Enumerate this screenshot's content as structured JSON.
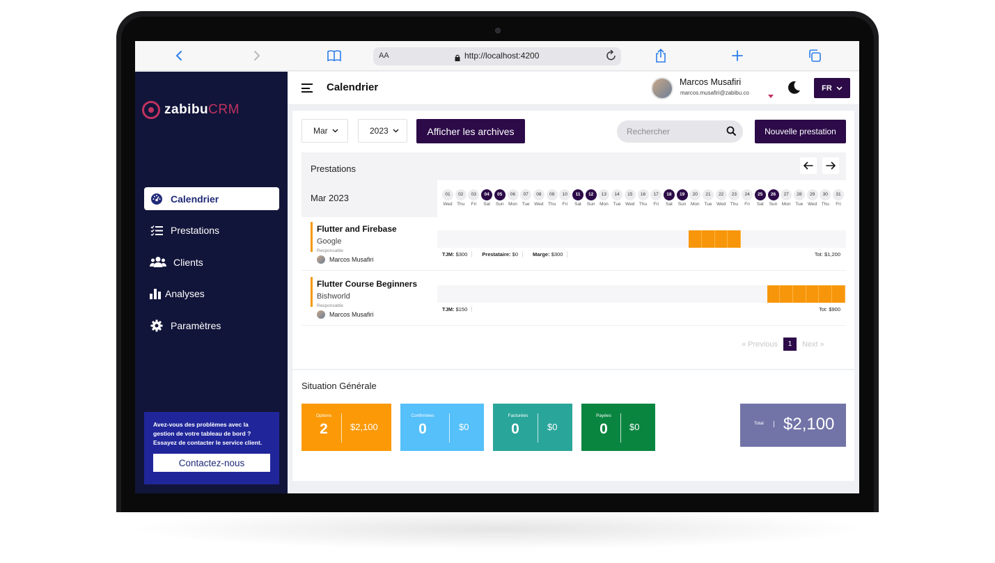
{
  "browser": {
    "url_aa": "AA",
    "url": "http://localhost:4200",
    "icons": [
      "back-icon",
      "forward-icon",
      "bookmarks-icon",
      "lock-icon",
      "reload-icon",
      "share-icon",
      "plus-icon",
      "tabs-icon"
    ]
  },
  "brand": {
    "name_main": "zabibu",
    "name_suffix": "CRM",
    "color": "#c0325f"
  },
  "sidebar": {
    "items": [
      {
        "label": "Calendrier",
        "icon": "dashboard-gauge-icon",
        "active": true
      },
      {
        "label": "Prestations",
        "icon": "checklist-icon",
        "active": false
      },
      {
        "label": "Clients",
        "icon": "users-icon",
        "active": false
      },
      {
        "label": "Analyses",
        "icon": "bar-chart-icon",
        "active": false
      },
      {
        "label": "Paramètres",
        "icon": "gear-icon",
        "active": false
      }
    ],
    "help_text": "Avez-vous des problèmes avec la gestion de votre tableau de bord ? Essayez de contacter le service client.",
    "help_button": "Contactez-nous"
  },
  "header": {
    "title": "Calendrier",
    "user_name": "Marcos Musafiri",
    "user_email": "marcos.musafiri@zabibu.co",
    "lang": "FR"
  },
  "filters": {
    "month": "Mar",
    "year": "2023",
    "archive_button": "Afficher les archives",
    "search_placeholder": "Rechercher",
    "new_button": "Nouvelle prestation"
  },
  "calendar": {
    "title": "Prestations",
    "month_label": "Mar 2023",
    "days": [
      {
        "num": "01",
        "name": "Wed",
        "hl": false
      },
      {
        "num": "02",
        "name": "Thu",
        "hl": false
      },
      {
        "num": "03",
        "name": "Fri",
        "hl": false
      },
      {
        "num": "04",
        "name": "Sat",
        "hl": true
      },
      {
        "num": "05",
        "name": "Sun",
        "hl": true
      },
      {
        "num": "06",
        "name": "Mon",
        "hl": false
      },
      {
        "num": "07",
        "name": "Tue",
        "hl": false
      },
      {
        "num": "08",
        "name": "Wed",
        "hl": false
      },
      {
        "num": "09",
        "name": "Thu",
        "hl": false
      },
      {
        "num": "10",
        "name": "Fri",
        "hl": false
      },
      {
        "num": "11",
        "name": "Sat",
        "hl": true
      },
      {
        "num": "12",
        "name": "Sun",
        "hl": true
      },
      {
        "num": "13",
        "name": "Mon",
        "hl": false
      },
      {
        "num": "14",
        "name": "Tue",
        "hl": false
      },
      {
        "num": "15",
        "name": "Wed",
        "hl": false
      },
      {
        "num": "16",
        "name": "Thu",
        "hl": false
      },
      {
        "num": "17",
        "name": "Fri",
        "hl": false
      },
      {
        "num": "18",
        "name": "Sat",
        "hl": true
      },
      {
        "num": "19",
        "name": "Sun",
        "hl": true
      },
      {
        "num": "20",
        "name": "Mon",
        "hl": false
      },
      {
        "num": "21",
        "name": "Tue",
        "hl": false
      },
      {
        "num": "22",
        "name": "Wed",
        "hl": false
      },
      {
        "num": "23",
        "name": "Thu",
        "hl": false
      },
      {
        "num": "24",
        "name": "Fri",
        "hl": false
      },
      {
        "num": "25",
        "name": "Sat",
        "hl": true
      },
      {
        "num": "26",
        "name": "Sun",
        "hl": true
      },
      {
        "num": "27",
        "name": "Mon",
        "hl": false
      },
      {
        "num": "28",
        "name": "Tue",
        "hl": false
      },
      {
        "num": "29",
        "name": "Wed",
        "hl": false
      },
      {
        "num": "30",
        "name": "Thu",
        "hl": false
      },
      {
        "num": "31",
        "name": "Fri",
        "hl": false
      }
    ],
    "rows": [
      {
        "title": "Flutter and Firebase",
        "client": "Google",
        "resp_label": "Responsable",
        "resp_name": "Marcos Musafiri",
        "booked_days": [
          20,
          21,
          22,
          23
        ],
        "meta": [
          {
            "k": "TJM:",
            "v": "$300"
          },
          {
            "k": "Prestataire:",
            "v": "$0"
          },
          {
            "k": "Marge:",
            "v": "$300"
          }
        ],
        "total": "Tot: $1,200"
      },
      {
        "title": "Flutter Course Beginners",
        "client": "Bishworld",
        "resp_label": "Responsable",
        "resp_name": "Marcos Musafiri",
        "booked_days": [
          26,
          27,
          28,
          29,
          30,
          31
        ],
        "meta": [
          {
            "k": "TJM:",
            "v": "$150"
          }
        ],
        "total": "Tot: $900"
      }
    ],
    "bar_color": "#f7960a"
  },
  "pagination": {
    "previous": "« Previous",
    "current": "1",
    "next": "Next »"
  },
  "summary": {
    "title": "Situation Générale",
    "cards": [
      {
        "label": "Options",
        "count": "2",
        "amount": "$2,100",
        "color": "#fb9906"
      },
      {
        "label": "Confirmées",
        "count": "0",
        "amount": "$0",
        "color": "#55c0f9"
      },
      {
        "label": "Facturées",
        "count": "0",
        "amount": "$0",
        "color": "#2aa59a"
      },
      {
        "label": "Payées",
        "count": "0",
        "amount": "$0",
        "color": "#0a8540"
      }
    ],
    "total_label": "Total",
    "total_amount": "$2,100",
    "total_color": "#7274a8"
  }
}
